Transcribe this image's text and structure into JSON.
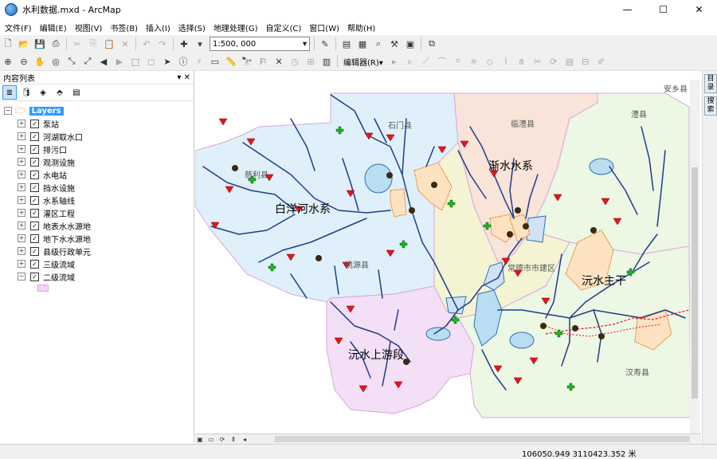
{
  "window": {
    "title": "水利数据.mxd - ArcMap",
    "minimize": "—",
    "maximize": "☐",
    "close": "✕"
  },
  "menu": [
    "文件(F)",
    "编辑(E)",
    "视图(V)",
    "书签(B)",
    "插入(I)",
    "选择(S)",
    "地理处理(G)",
    "自定义(C)",
    "窗口(W)",
    "帮助(H)"
  ],
  "toolbar": {
    "scale_value": "1:500, 000",
    "editor_label": "编辑器(R)▾"
  },
  "toc": {
    "title": "内容列表",
    "pin": "▾ ✕",
    "root_label": "Layers",
    "layers": [
      "泵站",
      "河湖取水口",
      "排污口",
      "观测设施",
      "水电站",
      "挡水设施",
      "水系轴线",
      "灌区工程",
      "地表水水源地",
      "地下水水源地",
      "县级行政单元",
      "三级流域",
      "二级流域"
    ]
  },
  "map": {
    "labels": {
      "anxiang": "安乡县",
      "lixian": "澧县",
      "linli": "临澧县",
      "shimen": "石门县",
      "cili": "慈利县",
      "taoyuan": "桃源县",
      "changde_city": "常德市市建区",
      "hanshou": "汉寿县",
      "baiyang_river": "白洋河水系",
      "jianshui_river": "渐水水系",
      "yuanshui_main": "沅水主干",
      "yuanshui_upper": "沅水上游段"
    },
    "colors": {
      "region_blue": "#dff0fa",
      "region_green": "#ecf7e4",
      "region_pink": "#f3dff6",
      "region_peach": "#f8e4d8",
      "region_yellow": "#f4f4d4",
      "river": "#1f3c8c",
      "pump_marker": "#e8141b",
      "intake_marker": "#1db31d"
    }
  },
  "status": {
    "coordinates": "106050.949  3110423.352 米"
  },
  "dock": {
    "tab1": "目录",
    "tab2": "搜索"
  }
}
